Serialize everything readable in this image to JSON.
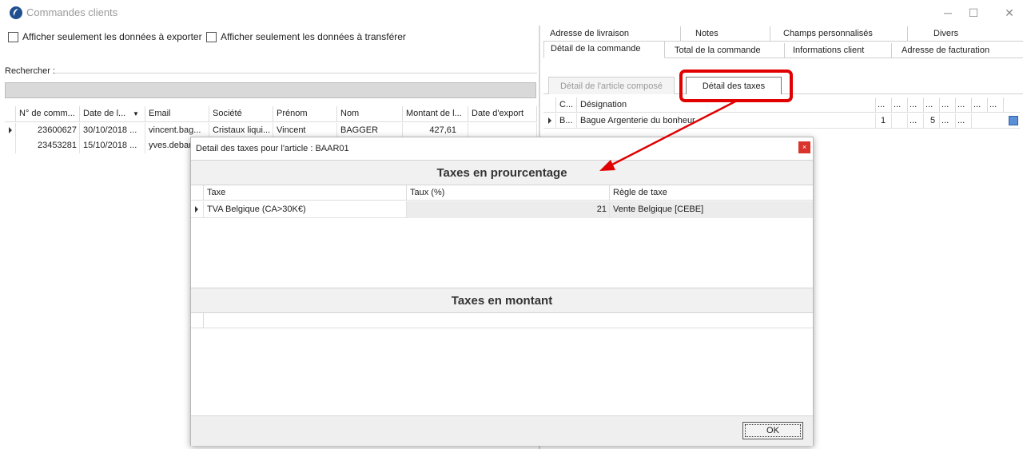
{
  "window": {
    "title": "Commandes clients",
    "minimize": "─",
    "maximize": "☐",
    "close": "✕"
  },
  "filters": {
    "export_only": "Afficher seulement les données à exporter",
    "transfer_only": "Afficher seulement les données à transférer"
  },
  "search": {
    "label": "Rechercher :",
    "value": ""
  },
  "orders_grid": {
    "columns": [
      "N° de comm...",
      "Date de l...",
      "Email",
      "Société",
      "Prénom",
      "Nom",
      "Montant de l...",
      "Date d'export"
    ],
    "sort_indicator": "▼",
    "rows": [
      [
        "23600627",
        "30/10/2018 ...",
        "vincent.bag...",
        "Cristaux liqui...",
        "Vincent",
        "BAGGER",
        "427,61",
        ""
      ],
      [
        "23453281",
        "15/10/2018 ...",
        "yves.debar",
        "",
        "",
        "",
        "",
        ""
      ]
    ]
  },
  "right_tabs": {
    "row1": [
      "Adresse de livraison",
      "Notes",
      "Champs personnalisés",
      "Divers"
    ],
    "row2": [
      "Détail de la commande",
      "Total de la commande",
      "Informations client",
      "Adresse de facturation"
    ]
  },
  "sub_tabs": {
    "composed": "Détail de l'article composé",
    "taxes": "Détail des taxes"
  },
  "detail_grid": {
    "headers": [
      "C...",
      "Désignation",
      "...",
      "...",
      "...",
      "...",
      "...",
      "...",
      "...",
      "..."
    ],
    "row": [
      "B...",
      "Bague Argenterie du bonheur",
      "1",
      "",
      "...",
      "5",
      "...",
      "..."
    ]
  },
  "dialog": {
    "title": "Detail des taxes pour l'article : BAAR01",
    "close": "×",
    "section_percent": "Taxes en prourcentage",
    "percent_columns": [
      "Taxe",
      "Taux (%)",
      "Règle de taxe"
    ],
    "percent_rows": [
      [
        "TVA Belgique (CA>30K€)",
        "21",
        "Vente Belgique [CEBE]"
      ]
    ],
    "section_amount": "Taxes en montant",
    "ok": "OK"
  },
  "colors": {
    "highlight": "#e00000",
    "selected_tab_border": "#777777"
  }
}
